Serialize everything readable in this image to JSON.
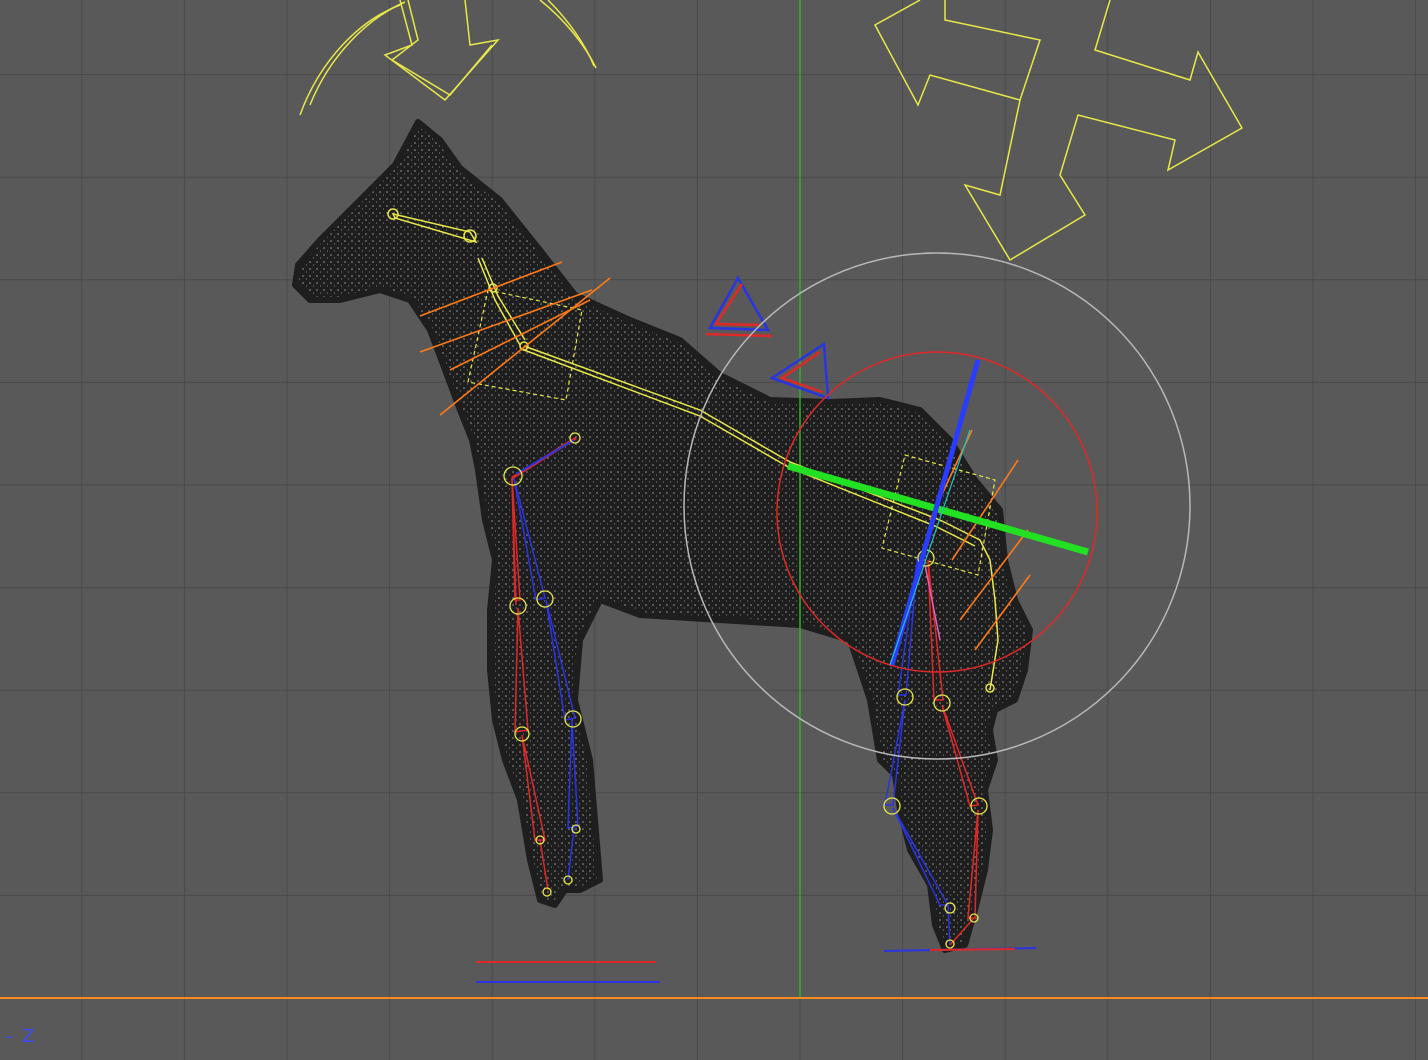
{
  "viewport": {
    "axis_label": "- Z",
    "colors": {
      "background": "#595959",
      "grid": "#4a4a4a",
      "vertical_axis": "#27b427",
      "ground_line": "#ff8a1e",
      "mesh": "#1e1e1e",
      "mesh_dots": "#8c8c8c",
      "bone_yellow": "#e8e84a",
      "bone_red": "#e02828",
      "bone_blue": "#2a34e0",
      "handle_orange": "#ff7a18",
      "gizmo_green": "#22e022",
      "gizmo_blue": "#2a3cff",
      "gizmo_red": "#e02828",
      "gizmo_white": "#b8b8b8"
    },
    "icons": [
      "rotate-arrows-icon",
      "move-cross-arrows-icon",
      "ik-target-triangle-icon"
    ]
  }
}
